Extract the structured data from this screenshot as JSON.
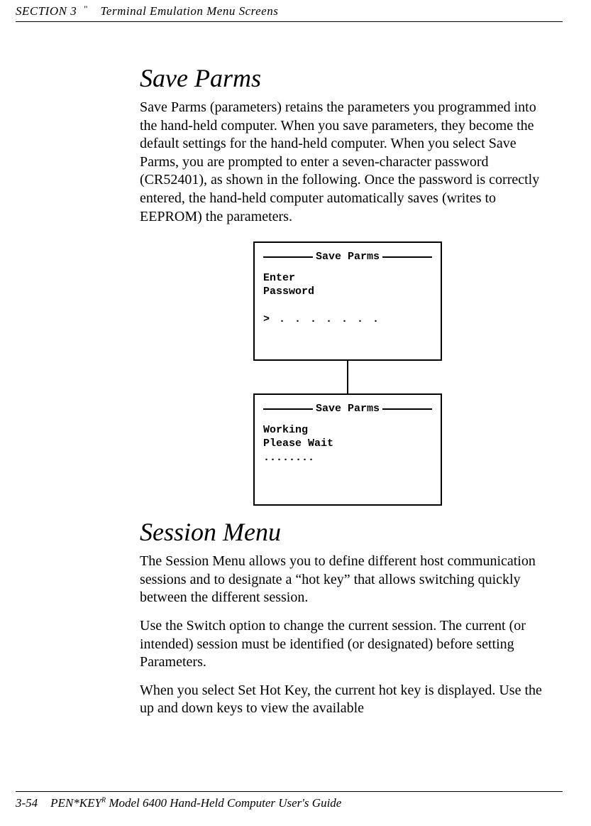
{
  "header": {
    "section_label": "SECTION 3",
    "quote": "\"",
    "title": "Terminal Emulation Menu Screens"
  },
  "section_save": {
    "heading": "Save Parms",
    "body": "Save Parms (parameters) retains the parameters you programmed into the hand-held computer.  When you save parameters, they become the default settings for the hand-held computer.  When you select Save Parms, you are prompted to enter a seven-character password (CR52401), as shown in the following.  Once the password is correctly entered, the hand-held computer automatically saves (writes to EEPROM) the parameters."
  },
  "screens": {
    "screen1": {
      "title": "Save Parms",
      "line1": "Enter",
      "line2": "Password",
      "prompt": "> . . . . . . ."
    },
    "screen2": {
      "title": "Save Parms",
      "line1": "Working",
      "line2": "Please Wait",
      "dots": "........"
    }
  },
  "section_session": {
    "heading": "Session Menu",
    "p1": "The Session Menu allows you to define different host communication sessions and to designate a “hot key” that allows switching quickly between the different session.",
    "p2": "Use the Switch option to change the current session.  The current (or intended) session must be identified (or designated) before setting Parameters.",
    "p3": "When you select Set Hot Key, the current hot key is displayed.  Use the up and down keys to view the available"
  },
  "footer": {
    "pagenum": "3-54",
    "product_prefix": "PEN*KEY",
    "product_sup": "R",
    "product_suffix": " Model 6400 Hand-Held Computer User's Guide"
  }
}
